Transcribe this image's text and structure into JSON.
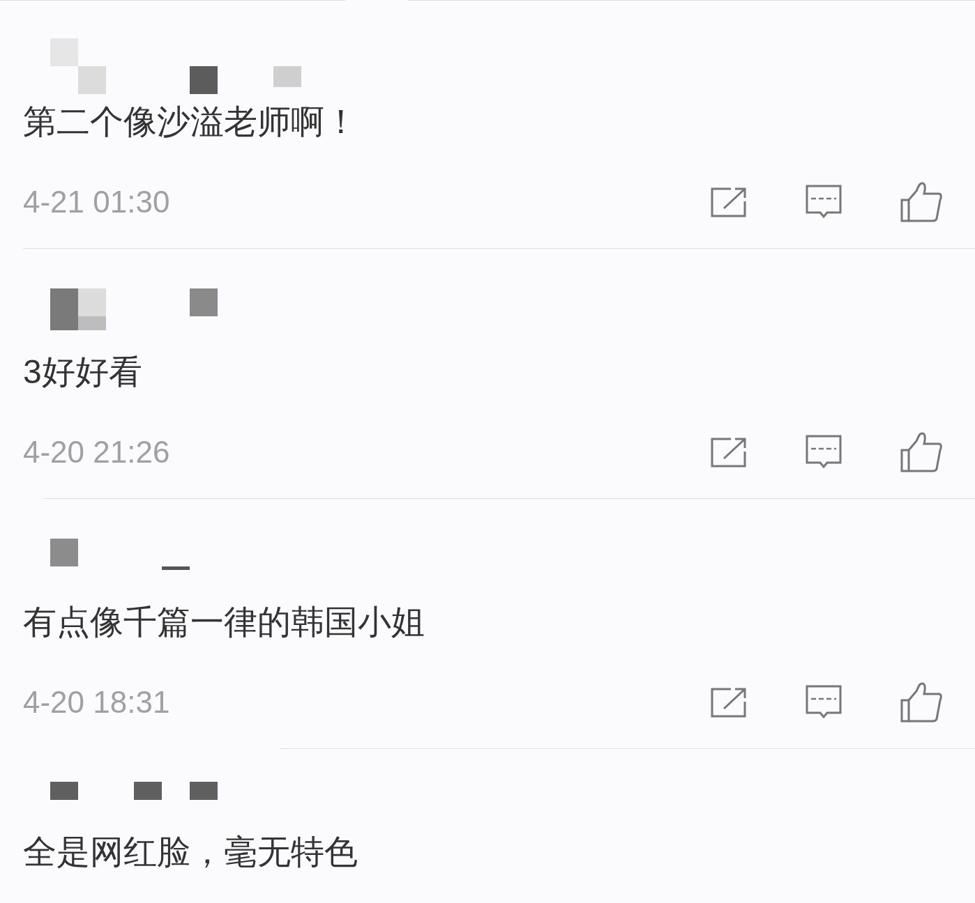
{
  "comments": [
    {
      "text": "第二个像沙溢老师啊！",
      "time": "4-21 01:30"
    },
    {
      "text": "3好好看",
      "time": "4-20 21:26"
    },
    {
      "text": "有点像千篇一律的韩国小姐",
      "time": "4-20 18:31"
    },
    {
      "text": "全是网红脸，毫无特色"
    }
  ]
}
